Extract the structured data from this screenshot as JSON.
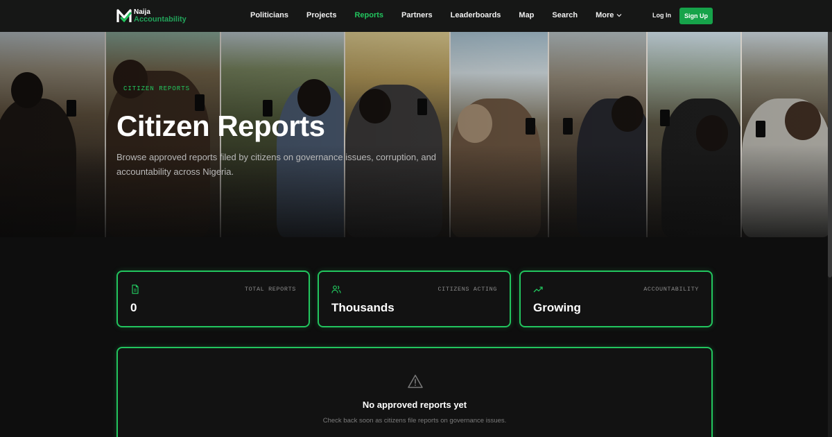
{
  "brand": {
    "line1": "Naija",
    "line2": "Accountability",
    "accent": "#22c55e"
  },
  "nav": {
    "items": [
      {
        "label": "Politicians"
      },
      {
        "label": "Projects"
      },
      {
        "label": "Reports",
        "active": true
      },
      {
        "label": "Partners"
      },
      {
        "label": "Leaderboards"
      },
      {
        "label": "Map"
      },
      {
        "label": "Search"
      },
      {
        "label": "More"
      }
    ],
    "login": "Log In",
    "signup": "Sign Up"
  },
  "hero": {
    "eyebrow": "CITIZEN REPORTS",
    "title": "Citizen Reports",
    "subtitle": "Browse approved reports filed by citizens on governance issues, corruption, and accountability across Nigeria."
  },
  "stats": [
    {
      "icon": "document-icon",
      "label": "TOTAL REPORTS",
      "value": "0"
    },
    {
      "icon": "users-icon",
      "label": "CITIZENS ACTING",
      "value": "Thousands"
    },
    {
      "icon": "trending-up-icon",
      "label": "ACCOUNTABILITY",
      "value": "Growing"
    }
  ],
  "empty": {
    "icon": "warning-icon",
    "title": "No approved reports yet",
    "subtitle": "Check back soon as citizens file reports on governance issues."
  }
}
